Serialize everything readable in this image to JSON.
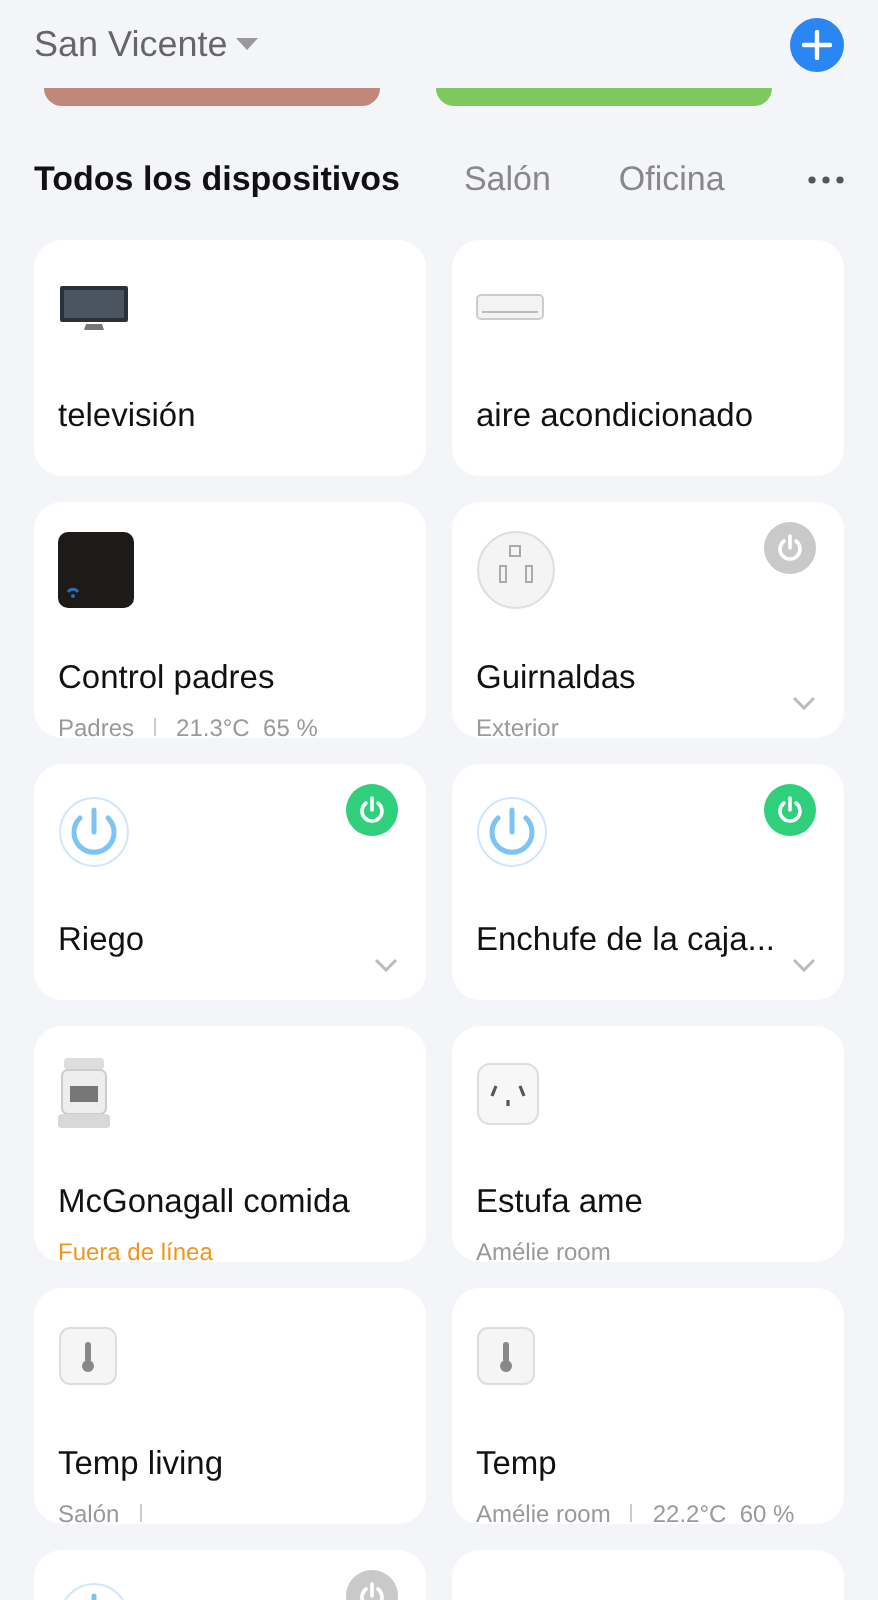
{
  "home": {
    "title": "San Vicente"
  },
  "scenes": [
    {
      "color": "#c1877a"
    },
    {
      "color": "#7dc95e"
    }
  ],
  "tabs": [
    {
      "label": "Todos los dispositivos",
      "selected": true
    },
    {
      "label": "Salón",
      "selected": false
    },
    {
      "label": "Oficina",
      "selected": false
    }
  ],
  "devices": [
    {
      "kind": "tv",
      "name": "televisión"
    },
    {
      "kind": "ac",
      "name": "aire acondicionado"
    },
    {
      "kind": "hub",
      "name": "Control padres",
      "room": "Padres",
      "divider": true,
      "readings": "21.3°C  65 %"
    },
    {
      "kind": "round-plug",
      "name": "Guirnaldas",
      "room": "Exterior",
      "on": false,
      "expandable": true
    },
    {
      "kind": "power",
      "name": "Riego",
      "on": true,
      "expandable": true
    },
    {
      "kind": "power",
      "name": "Enchufe de la caja...",
      "on": true,
      "expandable": true
    },
    {
      "kind": "robot",
      "name": "McGonagall comida",
      "room": "Fuera de línea",
      "offline": true
    },
    {
      "kind": "square-plug",
      "name": "Estufa ame",
      "room": "Amélie room"
    },
    {
      "kind": "sensor",
      "name": "Temp living",
      "room": "Salón",
      "divider": true
    },
    {
      "kind": "sensor",
      "name": "Temp",
      "room": "Amélie room",
      "divider": true,
      "readings": "22.2°C  60 %"
    },
    {
      "kind": "power",
      "on": false
    },
    {
      "kind": "strip"
    }
  ]
}
